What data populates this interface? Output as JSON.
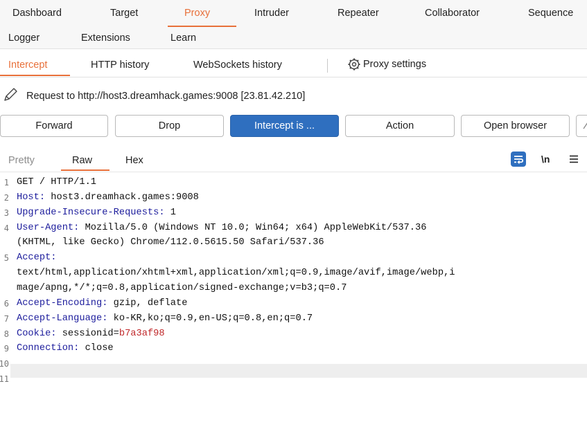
{
  "main_tabs_row1": [
    "Dashboard",
    "Target",
    "Proxy",
    "Intruder",
    "Repeater",
    "Collaborator",
    "Sequence"
  ],
  "main_tabs_row2": [
    "Logger",
    "Extensions",
    "Learn"
  ],
  "sub_tabs": [
    "Intercept",
    "HTTP history",
    "WebSockets history"
  ],
  "proxy_settings_label": "Proxy settings",
  "request_info": "Request to http://host3.dreamhack.games:9008  [23.81.42.210]",
  "buttons": {
    "forward": "Forward",
    "drop": "Drop",
    "intercept": "Intercept is ...",
    "action": "Action",
    "open_browser": "Open browser"
  },
  "view_tabs": [
    "Pretty",
    "Raw",
    "Hex"
  ],
  "view_icons": {
    "wrap": "wrap-lines-icon",
    "newline": "\\n",
    "menu": "menu-icon"
  },
  "request_lines": [
    {
      "num": "1",
      "h": "",
      "v": "GET / HTTP/1.1"
    },
    {
      "num": "2",
      "h": "Host:",
      "v": " host3.dreamhack.games:9008"
    },
    {
      "num": "3",
      "h": "Upgrade-Insecure-Requests:",
      "v": " 1"
    },
    {
      "num": "4",
      "h": "User-Agent:",
      "v": " Mozilla/5.0 (Windows NT 10.0; Win64; x64) AppleWebKit/537.36"
    },
    {
      "num": "",
      "h": "",
      "v": "(KHTML, like Gecko) Chrome/112.0.5615.50 Safari/537.36"
    },
    {
      "num": "5",
      "h": "Accept:",
      "v": ""
    },
    {
      "num": "",
      "h": "",
      "v": "text/html,application/xhtml+xml,application/xml;q=0.9,image/avif,image/webp,i"
    },
    {
      "num": "",
      "h": "",
      "v": "mage/apng,*/*;q=0.8,application/signed-exchange;v=b3;q=0.7"
    },
    {
      "num": "6",
      "h": "Accept-Encoding:",
      "v": " gzip, deflate"
    },
    {
      "num": "7",
      "h": "Accept-Language:",
      "v": " ko-KR,ko;q=0.9,en-US;q=0.8,en;q=0.7"
    },
    {
      "num": "8",
      "h": "Cookie:",
      "v": " sessionid=",
      "ck": "b7a3af98"
    },
    {
      "num": "9",
      "h": "Connection:",
      "v": " close"
    },
    {
      "num": "10",
      "h": "",
      "v": ""
    },
    {
      "num": "11",
      "h": "",
      "v": ""
    }
  ],
  "colors": {
    "accent": "#e8703a",
    "primary_button": "#2f6fbf",
    "header_name": "#1c1c9c",
    "cookie_value": "#c0282a",
    "wrap_icon": "#2f6fbf"
  }
}
